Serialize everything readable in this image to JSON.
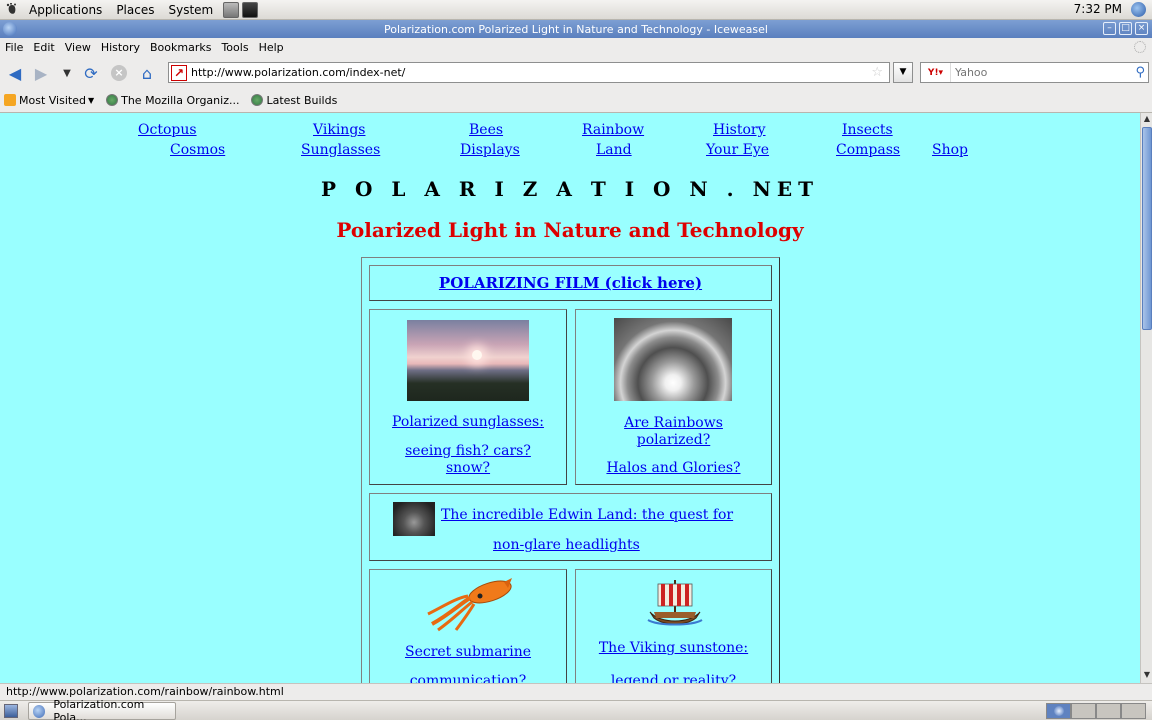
{
  "panel": {
    "menus": [
      "Applications",
      "Places",
      "System"
    ],
    "clock": "7:32 PM"
  },
  "window": {
    "title": "Polarization.com Polarized Light in Nature and Technology - Iceweasel"
  },
  "menubar": [
    "File",
    "Edit",
    "View",
    "History",
    "Bookmarks",
    "Tools",
    "Help"
  ],
  "nav": {
    "url": "http://www.polarization.com/index-net/",
    "search_placeholder": "Yahoo"
  },
  "bookmarks": {
    "most_visited": "Most Visited",
    "mozilla": "The Mozilla Organiz...",
    "latest_builds": "Latest Builds"
  },
  "page": {
    "top_links_row1": [
      "Octopus",
      "Vikings",
      "Bees",
      "Rainbow",
      "History",
      "Insects"
    ],
    "top_links_row2": [
      "Cosmos",
      "Sunglasses",
      "Displays",
      "Land",
      "Your Eye",
      "Compass",
      "Shop"
    ],
    "title": "P O L A R I Z A T I O N . NET",
    "subtitle": "Polarized Light in Nature and Technology",
    "film_link": "POLARIZING FILM (click here)",
    "sunglasses": {
      "line1": "Polarized sunglasses:",
      "line2": "seeing fish? cars? snow?"
    },
    "rainbow": {
      "line1": "Are Rainbows polarized?",
      "line2": "Halos and Glories?"
    },
    "land": {
      "line1": "The incredible Edwin Land: the quest for",
      "line2": "non-glare headlights"
    },
    "submarine": {
      "line1": "Secret submarine",
      "line2": "communication?"
    },
    "viking": {
      "line1": "The Viking sunstone:",
      "line2": "legend or reality?"
    }
  },
  "status": "http://www.polarization.com/rainbow/rainbow.html",
  "taskbar": {
    "window_button": "Polarization.com Pola..."
  }
}
